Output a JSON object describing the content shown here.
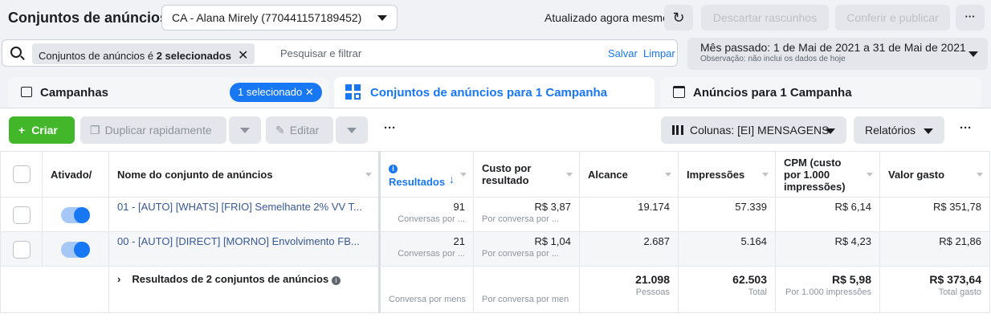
{
  "header": {
    "title": "Conjuntos de anúncios",
    "account": "CA - Alana Mirely (770441157189452)",
    "updated": "Atualizado agora mesmo",
    "discard": "Descartar rascunhos",
    "review": "Conferir e publicar",
    "more": "···"
  },
  "filter": {
    "chip_prefix": "Conjuntos de anúncios é ",
    "chip_bold": "2 selecionados",
    "placeholder": "Pesquisar e filtrar",
    "save": "Salvar",
    "clear": "Limpar"
  },
  "date": {
    "line1": "Mês passado: 1 de Mai de 2021 a 31 de Mai de 2021",
    "line2": "Observação: não inclui os dados de hoje"
  },
  "tabs": {
    "campaigns": "Campanhas",
    "selected": "1 selecionado ✕",
    "adsets": "Conjuntos de anúncios para 1 Campanha",
    "ads": "Anúncios para 1 Campanha"
  },
  "toolbar": {
    "create": "Criar",
    "duplicate": "Duplicar rapidamente",
    "edit": "Editar",
    "more": "···",
    "columns": "Colunas: [EI] MENSAGENS",
    "reports": "Relatórios",
    "more2": "···"
  },
  "columns": {
    "active": "Ativado/",
    "name": "Nome do conjunto de anúncios",
    "results": "Resultados",
    "cost": "Custo por resultado",
    "reach": "Alcance",
    "impressions": "Impressões",
    "cpm": "CPM (custo por 1.000 impressões)",
    "spent": "Valor gasto"
  },
  "rows": [
    {
      "name": "01 - [AUTO] [WHATS] [FRIO] Semelhante 2% VV T...",
      "results": "91",
      "results_sub": "Conversas por ...",
      "cost": "R$ 3,87",
      "cost_sub": "Por conversa por ...",
      "reach": "19.174",
      "impressions": "57.339",
      "cpm": "R$ 6,14",
      "spent": "R$ 351,78"
    },
    {
      "name": "00 - [AUTO] [DIRECT] [MORNO] Envolvimento FB...",
      "results": "21",
      "results_sub": "Conversas por ...",
      "cost": "R$ 1,04",
      "cost_sub": "Por conversa por ...",
      "reach": "2.687",
      "impressions": "5.164",
      "cpm": "R$ 4,23",
      "spent": "R$ 21,86"
    }
  ],
  "totals": {
    "label": "Resultados de 2 conjuntos de anúncios",
    "results_sub": "Conversa por mens",
    "cost_sub": "Por conversa por men",
    "reach": "21.098",
    "reach_sub": "Pessoas",
    "impressions": "62.503",
    "impressions_sub": "Total",
    "cpm": "R$ 5,98",
    "cpm_sub": "Por 1.000 impressões",
    "spent": "R$ 373,64",
    "spent_sub": "Total gasto"
  }
}
